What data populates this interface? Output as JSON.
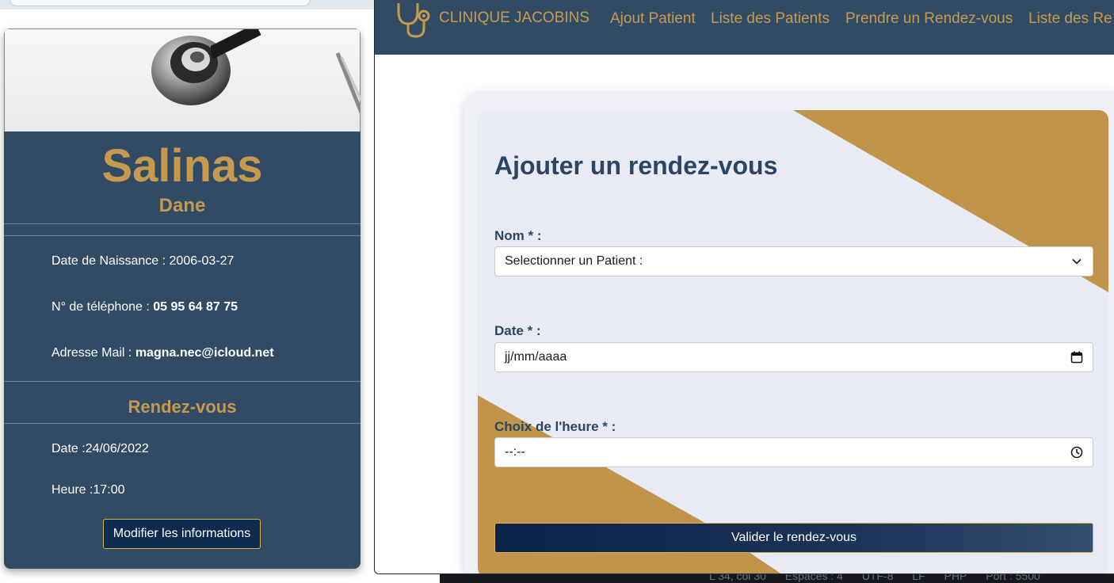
{
  "patient_card": {
    "last_name": "Salinas",
    "first_name": "Dane",
    "birth_label": "Date de Naissance : ",
    "birth_value": "2006-03-27",
    "phone_label": "N° de téléphone : ",
    "phone_value": "05 95 64 87 75",
    "email_label": "Adresse Mail : ",
    "email_value": "magna.nec@icloud.net",
    "appointment_title": "Rendez-vous",
    "appointment_date": "Date :24/06/2022",
    "appointment_time": "Heure :17:00",
    "edit_button": "Modifier les informations"
  },
  "navbar": {
    "brand": "CLINIQUE JACOBINS",
    "links": [
      "Ajout Patient",
      "Liste des Patients",
      "Prendre un Rendez-vous",
      "Liste des Re"
    ]
  },
  "form": {
    "title": "Ajouter un rendez-vous",
    "name_label": "Nom * :",
    "name_select_value": "Selectionner un Patient :",
    "date_label": "Date * :",
    "date_placeholder": "jj/mm/aaaa",
    "time_label": "Choix de l'heure * :",
    "time_placeholder": "--:--",
    "submit_button": "Valider le rendez-vous"
  },
  "editor_status_bar": [
    "L 34, col 30",
    "Espaces : 4",
    "UTF-8",
    "LF",
    "PHP",
    "Port : 5500"
  ],
  "colors": {
    "navy": "#324b65",
    "gold": "#c69a4e",
    "form_bg": "#e9ebf4"
  },
  "icons": [
    "stethoscope-icon",
    "chevron-down-icon",
    "calendar-icon",
    "clock-icon"
  ]
}
